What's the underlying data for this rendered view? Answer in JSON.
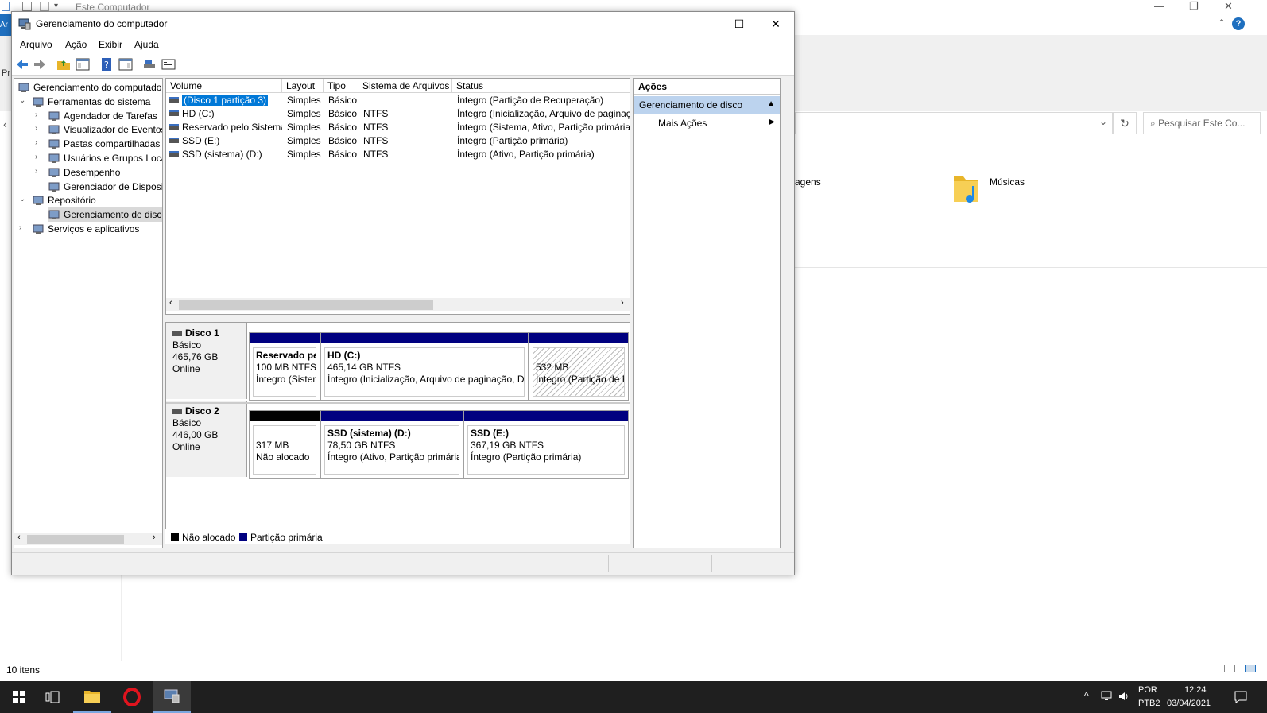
{
  "explorer": {
    "title": "Este Computador",
    "ribbon_tab": "Ar",
    "pr_label": "Pr",
    "search_placeholder": "Pesquisar Este Co...",
    "folder_imagens": "agens",
    "folder_musicas": "Músicas",
    "status": "10 itens"
  },
  "window": {
    "title": "Gerenciamento do computador",
    "menu": [
      "Arquivo",
      "Ação",
      "Exibir",
      "Ajuda"
    ]
  },
  "tree": [
    {
      "label": "Gerenciamento do computado",
      "level": 0,
      "arrow": ""
    },
    {
      "label": "Ferramentas do sistema",
      "level": 1,
      "arrow": "down"
    },
    {
      "label": "Agendador de Tarefas",
      "level": 2,
      "arrow": "right"
    },
    {
      "label": "Visualizador de Eventos",
      "level": 2,
      "arrow": "right"
    },
    {
      "label": "Pastas compartilhadas",
      "level": 2,
      "arrow": "right"
    },
    {
      "label": "Usuários e Grupos Loca",
      "level": 2,
      "arrow": "right"
    },
    {
      "label": "Desempenho",
      "level": 2,
      "arrow": "right"
    },
    {
      "label": "Gerenciador de Disposit",
      "level": 2,
      "arrow": ""
    },
    {
      "label": "Repositório",
      "level": 1,
      "arrow": "down"
    },
    {
      "label": "Gerenciamento de disco",
      "level": 2,
      "arrow": "",
      "selected": true
    },
    {
      "label": "Serviços e aplicativos",
      "level": 1,
      "arrow": "right"
    }
  ],
  "volumes": {
    "columns": [
      "Volume",
      "Layout",
      "Tipo",
      "Sistema de Arquivos",
      "Status"
    ],
    "rows": [
      {
        "volume": "(Disco 1 partição 3)",
        "layout": "Simples",
        "tipo": "Básico",
        "fs": "",
        "status": "Íntegro (Partição de Recuperação)",
        "selected": true
      },
      {
        "volume": "HD (C:)",
        "layout": "Simples",
        "tipo": "Básico",
        "fs": "NTFS",
        "status": "Íntegro (Inicialização, Arquivo de paginaçã"
      },
      {
        "volume": "Reservado pelo Sistema",
        "layout": "Simples",
        "tipo": "Básico",
        "fs": "NTFS",
        "status": "Íntegro (Sistema, Ativo, Partição primária)"
      },
      {
        "volume": "SSD (E:)",
        "layout": "Simples",
        "tipo": "Básico",
        "fs": "NTFS",
        "status": "Íntegro (Partição primária)"
      },
      {
        "volume": "SSD (sistema) (D:)",
        "layout": "Simples",
        "tipo": "Básico",
        "fs": "NTFS",
        "status": "Íntegro (Ativo, Partição primária)"
      }
    ]
  },
  "disks": [
    {
      "name": "Disco 1",
      "type": "Básico",
      "size": "465,76 GB",
      "state": "Online",
      "partitions": [
        {
          "title": "Reservado pe",
          "line1": "100 MB NTFS",
          "line2": "Íntegro (Sistem",
          "bar": "#000080"
        },
        {
          "title": "HD  (C:)",
          "line1": "465,14 GB NTFS",
          "line2": "Íntegro (Inicialização, Arquivo de paginação, De",
          "bar": "#000080"
        },
        {
          "title": "",
          "line1": "532 MB",
          "line2": "Íntegro (Partição de R",
          "bar": "#000080",
          "hatched": true
        }
      ]
    },
    {
      "name": "Disco 2",
      "type": "Básico",
      "size": "446,00 GB",
      "state": "Online",
      "partitions": [
        {
          "title": "",
          "line1": "317 MB",
          "line2": "Não alocado",
          "bar": "#000000"
        },
        {
          "title": "SSD (sistema)  (D:)",
          "line1": "78,50 GB NTFS",
          "line2": "Íntegro (Ativo, Partição primária",
          "bar": "#000080"
        },
        {
          "title": "SSD  (E:)",
          "line1": "367,19 GB NTFS",
          "line2": "Íntegro (Partição primária)",
          "bar": "#000080"
        }
      ]
    }
  ],
  "legend": [
    {
      "label": "Não alocado",
      "color": "#000000"
    },
    {
      "label": "Partição primária",
      "color": "#000080"
    }
  ],
  "actions": {
    "header": "Ações",
    "selected": "Gerenciamento de disco",
    "more": "Mais Ações"
  },
  "taskbar": {
    "lang1": "POR",
    "lang2": "PTB2",
    "time": "12:24",
    "date": "03/04/2021"
  }
}
